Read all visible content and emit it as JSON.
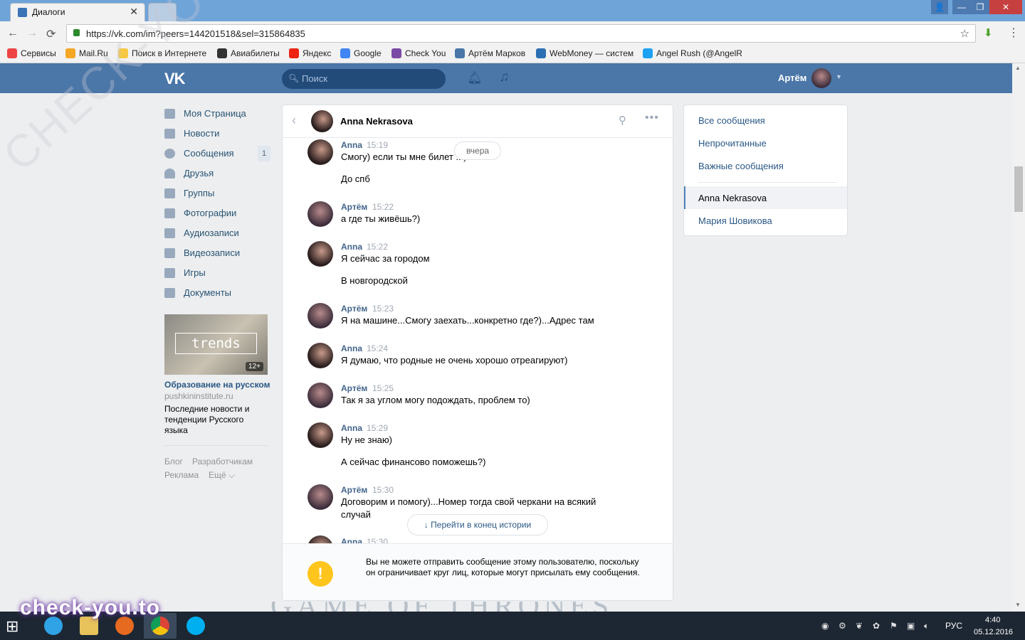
{
  "browser": {
    "tab_title": "Диалоги",
    "url": "https://vk.com/im?peers=144201518&sel=315864835",
    "bookmarks": [
      "Сервисы",
      "Mail.Ru",
      "Поиск в Интернете",
      "Авиабилеты",
      "Яндекс",
      "Google",
      "Check You",
      "Артём Марков",
      "WebMoney — систем",
      "Angel Rush (@AngelR"
    ]
  },
  "header": {
    "logo": "VK",
    "search_placeholder": "Поиск",
    "user_name": "Артём"
  },
  "left_menu": {
    "items": [
      "Моя Страница",
      "Новости",
      "Сообщения",
      "Друзья",
      "Группы",
      "Фотографии",
      "Аудиозаписи",
      "Видеозаписи",
      "Игры",
      "Документы"
    ],
    "messages_badge": "1",
    "ad": {
      "image_word": "trends",
      "age": "12+",
      "title": "Образование на русском",
      "domain": "pushkininstitute.ru",
      "text": "Последние новости и тенденции Русского языка"
    },
    "footer": [
      "Блог",
      "Разработчикам",
      "Реклама",
      "Ещё ⌵"
    ]
  },
  "dialog": {
    "contact_name": "Anna Nekrasova",
    "date_pill": "вчера",
    "messages": [
      {
        "author": "Anna",
        "time": "15:19",
        "lines": [
          "Смогу) если ты мне билет ...)",
          "До спб"
        ]
      },
      {
        "author": "Артём",
        "time": "15:22",
        "lines": [
          "а где ты живёшь?)"
        ]
      },
      {
        "author": "Anna",
        "time": "15:22",
        "lines": [
          "Я сейчас за городом",
          "В новгородской"
        ]
      },
      {
        "author": "Артём",
        "time": "15:23",
        "lines": [
          "Я на машине...Смогу заехать...конкретно где?)...Адрес там"
        ]
      },
      {
        "author": "Anna",
        "time": "15:24",
        "lines": [
          "Я думаю, что родные не очень хорошо отреагируют)"
        ]
      },
      {
        "author": "Артём",
        "time": "15:25",
        "lines": [
          "Так я за углом могу подождать, проблем то)"
        ]
      },
      {
        "author": "Anna",
        "time": "15:29",
        "lines": [
          "Ну не знаю)",
          "А сейчас финансово поможешь?)"
        ]
      },
      {
        "author": "Артём",
        "time": "15:30",
        "lines": [
          "Договорим и помогу)...Номер тогда свой черкани на всякий случай"
        ]
      },
      {
        "author": "Anna",
        "time": "15:30",
        "lines": []
      }
    ],
    "scroll_to_end": "Перейти в конец истории",
    "warning": "Вы не можете отправить сообщение этому пользователю, поскольку он ограничивает круг лиц, которые могут присылать ему сообщения."
  },
  "filters": {
    "items": [
      "Все сообщения",
      "Непрочитанные",
      "Важные сообщения"
    ],
    "conversations": [
      "Anna Nekrasova",
      "Мария Шовикова"
    ],
    "active_conversation": "Anna Nekrasova"
  },
  "taskbar": {
    "lang": "РУС",
    "time": "4:40",
    "date": "05.12.2016"
  },
  "overlays": {
    "watermark_bottom": "check-you.to",
    "watermark_diag": "CHECK-YOU.ME",
    "backdrop_text": "GAME OF THRONES"
  }
}
